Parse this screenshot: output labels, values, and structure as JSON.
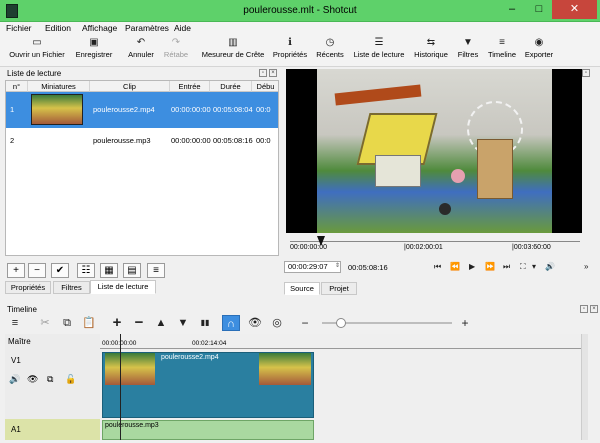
{
  "window": {
    "title": "poulerousse.mlt - Shotcut",
    "min_glyph": "–",
    "max_glyph": "□",
    "close_glyph": "✕"
  },
  "menu": [
    "Fichier",
    "Edition",
    "Affichage",
    "Paramètres",
    "Aide"
  ],
  "toolbar": [
    {
      "label": "Ouvrir un Fichier",
      "icon": "folder-open-icon",
      "glyph": "▭",
      "enabled": true
    },
    {
      "label": "Enregistrer",
      "icon": "save-icon",
      "glyph": "▣",
      "enabled": true
    },
    {
      "label": "Annuler",
      "icon": "undo-icon",
      "glyph": "↶",
      "enabled": true
    },
    {
      "label": "Rétabe",
      "icon": "redo-icon",
      "glyph": "↷",
      "enabled": false
    },
    {
      "label": "Mesureur de Crête",
      "icon": "peak-meter-icon",
      "glyph": "▥",
      "enabled": true
    },
    {
      "label": "Propriétés",
      "icon": "info-icon",
      "glyph": "ℹ",
      "enabled": true
    },
    {
      "label": "Récents",
      "icon": "clock-icon",
      "glyph": "◷",
      "enabled": true
    },
    {
      "label": "Liste de lecture",
      "icon": "list-icon",
      "glyph": "☰",
      "enabled": true
    },
    {
      "label": "Historique",
      "icon": "history-icon",
      "glyph": "⇆",
      "enabled": true
    },
    {
      "label": "Filtres",
      "icon": "filter-icon",
      "glyph": "▼",
      "enabled": true
    },
    {
      "label": "Timeline",
      "icon": "timeline-icon",
      "glyph": "≡",
      "enabled": true
    },
    {
      "label": "Exporter",
      "icon": "export-icon",
      "glyph": "◉",
      "enabled": true
    }
  ],
  "playlist": {
    "title": "Liste de lecture",
    "columns": [
      "n°",
      "Miniatures",
      "Clip",
      "Entrée",
      "Durée",
      "Débu"
    ],
    "rows": [
      {
        "n": "1",
        "clip": "poulerousse2.mp4",
        "in": "00:00:00:00",
        "duration": "00:05:08:04",
        "start": "00:0",
        "selected": true
      },
      {
        "n": "2",
        "clip": "poulerousse.mp3",
        "in": "00:00:00:00",
        "duration": "00:05:08:16",
        "start": "00:0",
        "selected": false
      }
    ],
    "buttons": [
      {
        "name": "add-button",
        "glyph": "+"
      },
      {
        "name": "remove-button",
        "glyph": "−"
      },
      {
        "name": "update-button",
        "glyph": "✔"
      },
      {
        "name": "view-details-button",
        "glyph": "☷"
      },
      {
        "name": "view-tiled-button",
        "glyph": "▦"
      },
      {
        "name": "view-icons-button",
        "glyph": "▤"
      },
      {
        "name": "menu-button",
        "glyph": "≡"
      }
    ],
    "tabs": [
      "Propriétés",
      "Filtres",
      "Liste de lecture"
    ],
    "active_tab": "Liste de lecture"
  },
  "player": {
    "ruler_labels": [
      "00:00:00:00",
      "|00:02:00:01",
      "|00:03:60:00"
    ],
    "current_tc": "00:00:29:07",
    "total_tc": "00:05:08:16",
    "tabs": [
      "Source",
      "Projet"
    ],
    "controls": [
      "⏮",
      "⏪",
      "▶",
      "⏩",
      "⏭",
      "⛶",
      "▾",
      "🔊"
    ],
    "more_glyph": "»"
  },
  "timeline": {
    "title": "Timeline",
    "tools": [
      "≡",
      "✂",
      "⧉",
      "📋",
      "+",
      "−",
      "▲",
      "▼",
      "▮▮",
      "∩",
      "👁",
      "◎",
      "−",
      "+"
    ],
    "ruler_labels": [
      "00:00:00:00",
      "00:02:14:04"
    ],
    "tracks": [
      {
        "label": "Maître"
      },
      {
        "label": "V1",
        "clip": "poulerousse2.mp4"
      },
      {
        "label": "A1",
        "clip": "poulerousse.mp3"
      }
    ],
    "track_icons": [
      "🔊",
      "👁",
      "⧉",
      "🔓"
    ]
  },
  "colors": {
    "titlebar": "#5ed16a",
    "selection": "#3d8ee0",
    "video_clip": "#2a7fa0",
    "audio_clip": "#a9d8a0"
  }
}
